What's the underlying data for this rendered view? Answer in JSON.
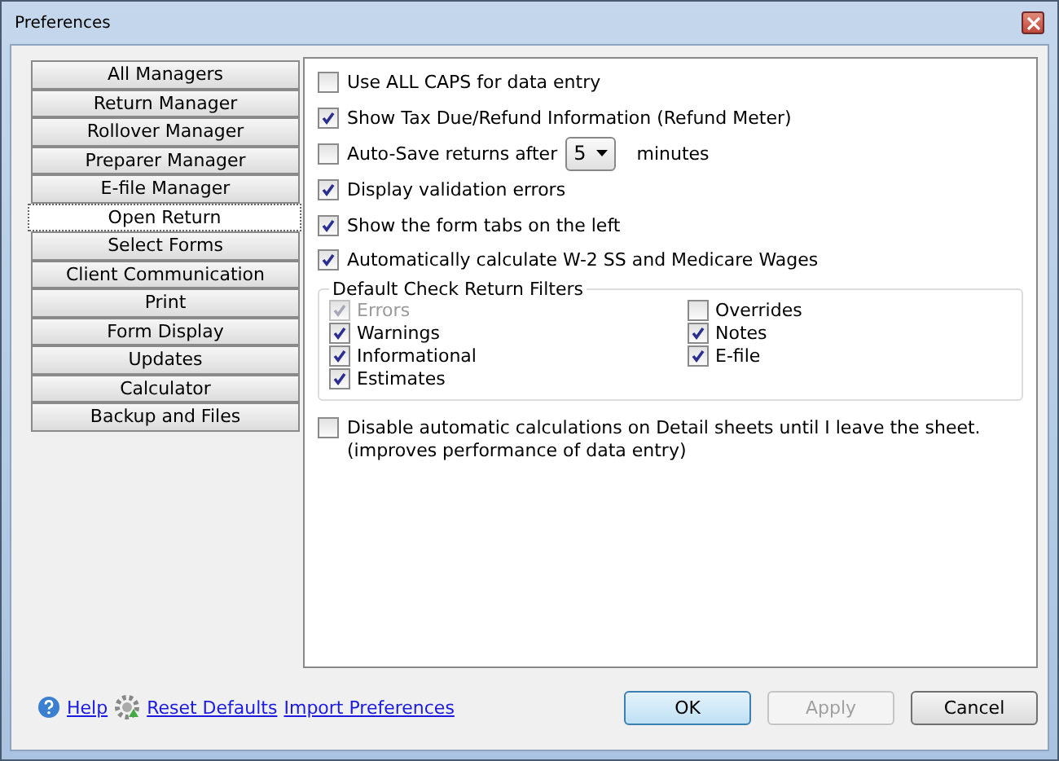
{
  "window": {
    "title": "Preferences"
  },
  "nav": [
    {
      "label": "All Managers",
      "selected": false
    },
    {
      "label": "Return Manager",
      "selected": false
    },
    {
      "label": "Rollover Manager",
      "selected": false
    },
    {
      "label": "Preparer Manager",
      "selected": false
    },
    {
      "label": "E-file Manager",
      "selected": false
    },
    {
      "label": "Open Return",
      "selected": true
    },
    {
      "label": "Select Forms",
      "selected": false
    },
    {
      "label": "Client Communication",
      "selected": false
    },
    {
      "label": "Print",
      "selected": false
    },
    {
      "label": "Form Display",
      "selected": false
    },
    {
      "label": "Updates",
      "selected": false
    },
    {
      "label": "Calculator",
      "selected": false
    },
    {
      "label": "Backup and Files",
      "selected": false
    }
  ],
  "options": [
    {
      "kind": "checkbox",
      "label": "Use ALL CAPS for data entry",
      "checked": false
    },
    {
      "kind": "checkbox",
      "label": "Show Tax Due/Refund Information (Refund Meter)",
      "checked": true
    },
    {
      "kind": "autosave",
      "label": "Auto-Save returns after",
      "value": "5",
      "suffix": "minutes",
      "checked": false
    },
    {
      "kind": "checkbox",
      "label": "Display validation errors",
      "checked": true
    },
    {
      "kind": "checkbox",
      "label": "Show the form tabs on the left",
      "checked": true
    },
    {
      "kind": "checkbox",
      "label": "Automatically calculate W-2 SS and Medicare Wages",
      "checked": true
    }
  ],
  "filters": {
    "title": "Default Check Return Filters",
    "columns": [
      [
        {
          "label": "Errors",
          "checked": true,
          "disabled": true
        },
        {
          "label": "Warnings",
          "checked": true,
          "disabled": false
        },
        {
          "label": "Informational",
          "checked": true,
          "disabled": false
        },
        {
          "label": "Estimates",
          "checked": true,
          "disabled": false
        }
      ],
      [
        {
          "label": "Overrides",
          "checked": false,
          "disabled": false
        },
        {
          "label": "Notes",
          "checked": true,
          "disabled": false
        },
        {
          "label": "E-file",
          "checked": true,
          "disabled": false
        }
      ]
    ]
  },
  "detail_option": {
    "label": "Disable automatic calculations on Detail sheets until I leave the sheet. (improves performance of data entry)",
    "checked": false
  },
  "links": [
    "Help",
    "Reset Defaults",
    "Import Preferences"
  ],
  "buttons": [
    {
      "label": "OK",
      "kind": "default",
      "disabled": false
    },
    {
      "label": "Apply",
      "kind": "normal",
      "disabled": true
    },
    {
      "label": "Cancel",
      "kind": "normal",
      "disabled": false
    }
  ]
}
